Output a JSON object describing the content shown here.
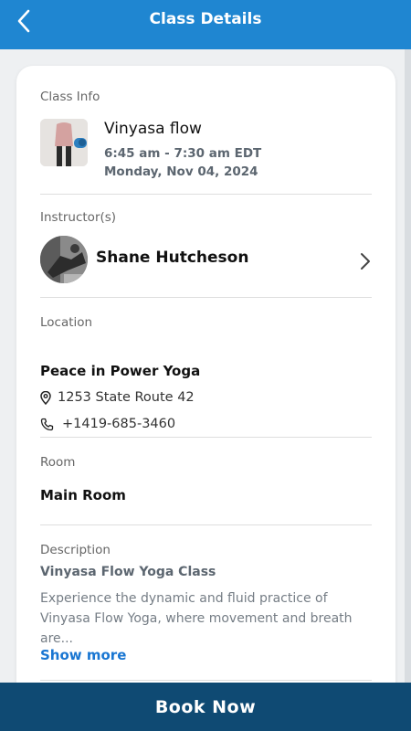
{
  "header": {
    "title": "Class Details",
    "back_icon": "chevron-left-icon"
  },
  "class_info": {
    "label": "Class Info",
    "name": "Vinyasa flow",
    "time": "6:45 am - 7:30 am EDT",
    "date": "Monday, Nov 04, 2024"
  },
  "instructor": {
    "label": "Instructor(s)",
    "name": "Shane Hutcheson"
  },
  "location": {
    "label": "Location",
    "name": "Peace in Power Yoga",
    "address": "1253 State Route 42",
    "phone": "+1419-685-3460"
  },
  "room": {
    "label": "Room",
    "name": "Main Room"
  },
  "description": {
    "label": "Description",
    "title": "Vinyasa Flow Yoga Class",
    "text": "Experience the dynamic and fluid practice of Vinyasa Flow Yoga, where movement and breath are...",
    "show_more": "Show more"
  },
  "footer": {
    "book_label": "Book Now"
  },
  "colors": {
    "header": "#1f86d1",
    "footer": "#0f4a73",
    "link": "#1976d2"
  }
}
